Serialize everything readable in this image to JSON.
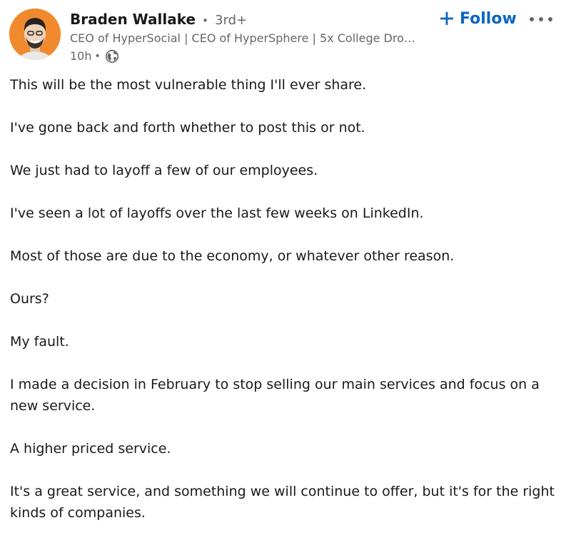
{
  "post": {
    "author": {
      "name": "Braden Wallake",
      "separator": "•",
      "degree": "3rd+",
      "headline": "CEO of HyperSocial | CEO of HyperSphere | 5x College Drop...",
      "time": "10h",
      "meta_separator": "•",
      "visibility_icon": "globe-icon",
      "avatar_bg": "#f08a2c"
    },
    "actions": {
      "follow_label": "Follow",
      "follow_icon": "plus-icon",
      "more_icon": "more-horizontal-icon",
      "accent": "#0a66c2"
    },
    "paragraphs": [
      "This will be the most vulnerable thing I'll ever share.",
      "I've gone back and forth whether to post this or not.",
      "We just had to layoff a few of our employees.",
      "I've seen a lot of layoffs over the last few weeks on LinkedIn.",
      "Most of those are due to the economy, or whatever other reason.",
      "Ours?",
      "My fault.",
      "I made a decision in February to stop selling our main services and focus on a new service.",
      "A higher priced service.",
      "It's a great service, and something we will continue to offer, but it's for the right kinds of companies."
    ]
  }
}
